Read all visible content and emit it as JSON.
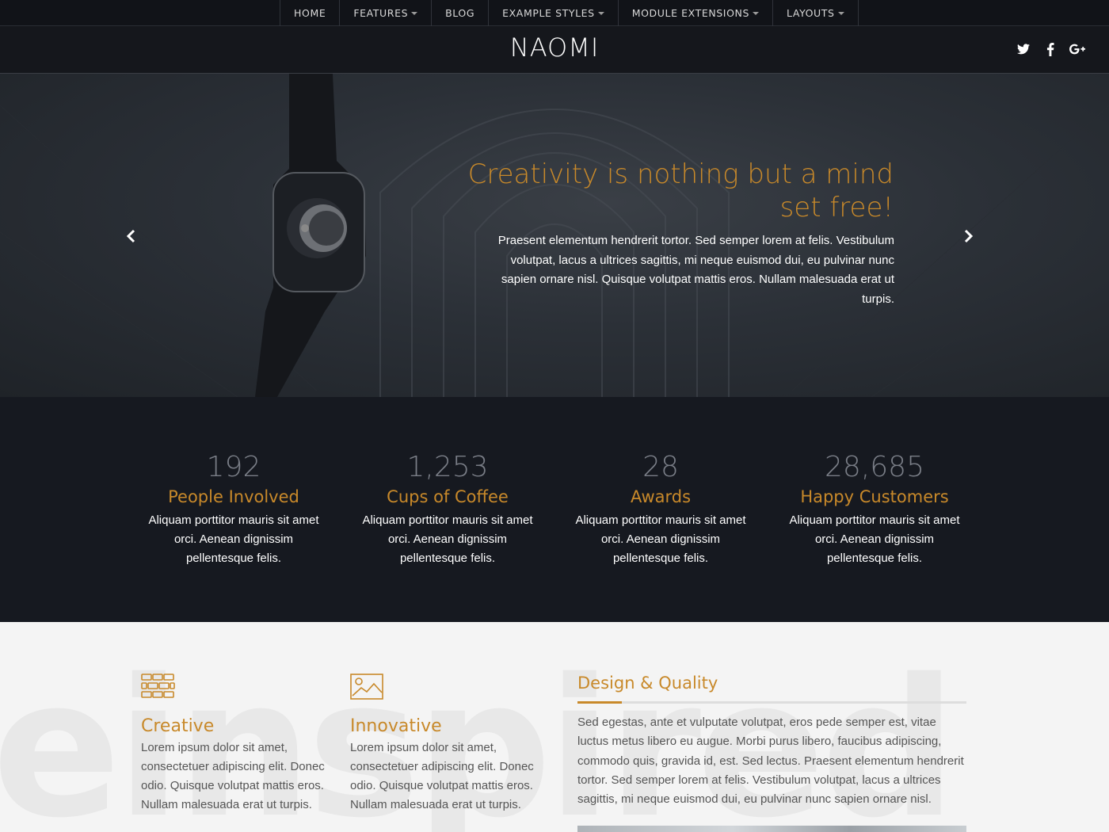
{
  "nav": {
    "items": [
      {
        "label": "HOME",
        "dropdown": false
      },
      {
        "label": "FEATURES",
        "dropdown": true
      },
      {
        "label": "BLOG",
        "dropdown": false
      },
      {
        "label": "EXAMPLE STYLES",
        "dropdown": true
      },
      {
        "label": "MODULE EXTENSIONS",
        "dropdown": true
      },
      {
        "label": "LAYOUTS",
        "dropdown": true
      }
    ]
  },
  "header": {
    "logo": "NAOMI",
    "social": [
      "twitter-icon",
      "facebook-icon",
      "google-plus-icon"
    ]
  },
  "hero": {
    "title": "Creativity is nothing but a mind set free!",
    "text": "Praesent elementum hendrerit tortor. Sed semper lorem at felis. Vestibulum volutpat, lacus a ultrices sagittis, mi neque euismod dui, eu pulvinar nunc sapien ornare nisl. Quisque volutpat mattis eros. Nullam malesuada erat ut turpis.",
    "prev_icon": "chevron-left-icon",
    "next_icon": "chevron-right-icon"
  },
  "stats": [
    {
      "number": "192",
      "label": "People Involved",
      "desc": "Aliquam porttitor mauris sit amet orci. Aenean dignissim pellentesque felis."
    },
    {
      "number": "1,253",
      "label": "Cups of Coffee",
      "desc": "Aliquam porttitor mauris sit amet orci. Aenean dignissim pellentesque felis."
    },
    {
      "number": "28",
      "label": "Awards",
      "desc": "Aliquam porttitor mauris sit amet orci. Aenean dignissim pellentesque felis."
    },
    {
      "number": "28,685",
      "label": "Happy Customers",
      "desc": "Aliquam porttitor mauris sit amet orci. Aenean dignissim pellentesque felis."
    }
  ],
  "bottom": {
    "watermark": "einspired",
    "features": [
      {
        "icon": "bricks-icon",
        "title": "Creative",
        "text": "Lorem ipsum dolor sit amet, consectetuer adipiscing elit. Donec odio. Quisque volutpat mattis eros. Nullam malesuada erat ut turpis."
      },
      {
        "icon": "image-icon",
        "title": "Innovative",
        "text": "Lorem ipsum dolor sit amet, consectetuer adipiscing elit. Donec odio. Quisque volutpat mattis eros. Nullam malesuada erat ut turpis."
      }
    ],
    "design_quality": {
      "title": "Design & Quality",
      "text": "Sed egestas, ante et vulputate volutpat, eros pede semper est, vitae luctus metus libero eu augue. Morbi purus libero, faucibus adipiscing, commodo quis, gravida id, est. Sed lectus. Praesent elementum hendrerit tortor. Sed semper lorem at felis. Vestibulum volutpat, lacus a ultrices sagittis, mi neque euismod dui, eu pulvinar nunc sapien ornare nisl."
    }
  },
  "colors": {
    "accent": "#c8892a",
    "nav_bg": "#111318",
    "stats_bg": "#161920",
    "light_bg": "#f4f4f4"
  }
}
